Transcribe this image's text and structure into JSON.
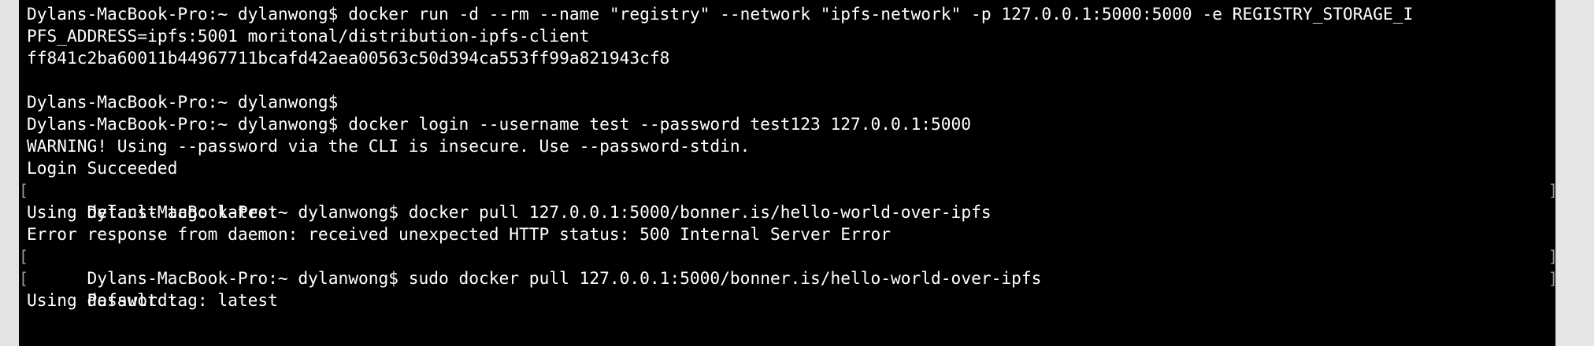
{
  "terminal": {
    "lines": [
      {
        "text": "Dylans-MacBook-Pro:~ dylanwong$ docker run -d --rm --name \"registry\" --network \"ipfs-network\" -p 127.0.0.1:5000:5000 -e REGISTRY_STORAGE_I",
        "bracketed": false
      },
      {
        "text": "PFS_ADDRESS=ipfs:5001 moritonal/distribution-ipfs-client",
        "bracketed": false
      },
      {
        "text": "ff841c2ba60011b44967711bcafd42aea00563c50d394ca553ff99a821943cf8",
        "bracketed": false
      },
      {
        "text": "",
        "bracketed": false
      },
      {
        "text": "Dylans-MacBook-Pro:~ dylanwong$",
        "bracketed": false
      },
      {
        "text": "Dylans-MacBook-Pro:~ dylanwong$ docker login --username test --password test123 127.0.0.1:5000",
        "bracketed": false
      },
      {
        "text": "WARNING! Using --password via the CLI is insecure. Use --password-stdin.",
        "bracketed": false
      },
      {
        "text": "Login Succeeded",
        "bracketed": false
      },
      {
        "text": "Dylans-MacBook-Pro:~ dylanwong$ docker pull 127.0.0.1:5000/bonner.is/hello-world-over-ipfs",
        "bracketed": true
      },
      {
        "text": "Using default tag: latest",
        "bracketed": false
      },
      {
        "text": "Error response from daemon: received unexpected HTTP status: 500 Internal Server Error",
        "bracketed": false
      },
      {
        "text": "Dylans-MacBook-Pro:~ dylanwong$ sudo docker pull 127.0.0.1:5000/bonner.is/hello-world-over-ipfs",
        "bracketed": true
      },
      {
        "text": "Password:",
        "bracketed": true
      },
      {
        "text": "Using default tag: latest",
        "bracketed": false
      }
    ],
    "bracket_left": "[",
    "bracket_right": "]"
  }
}
